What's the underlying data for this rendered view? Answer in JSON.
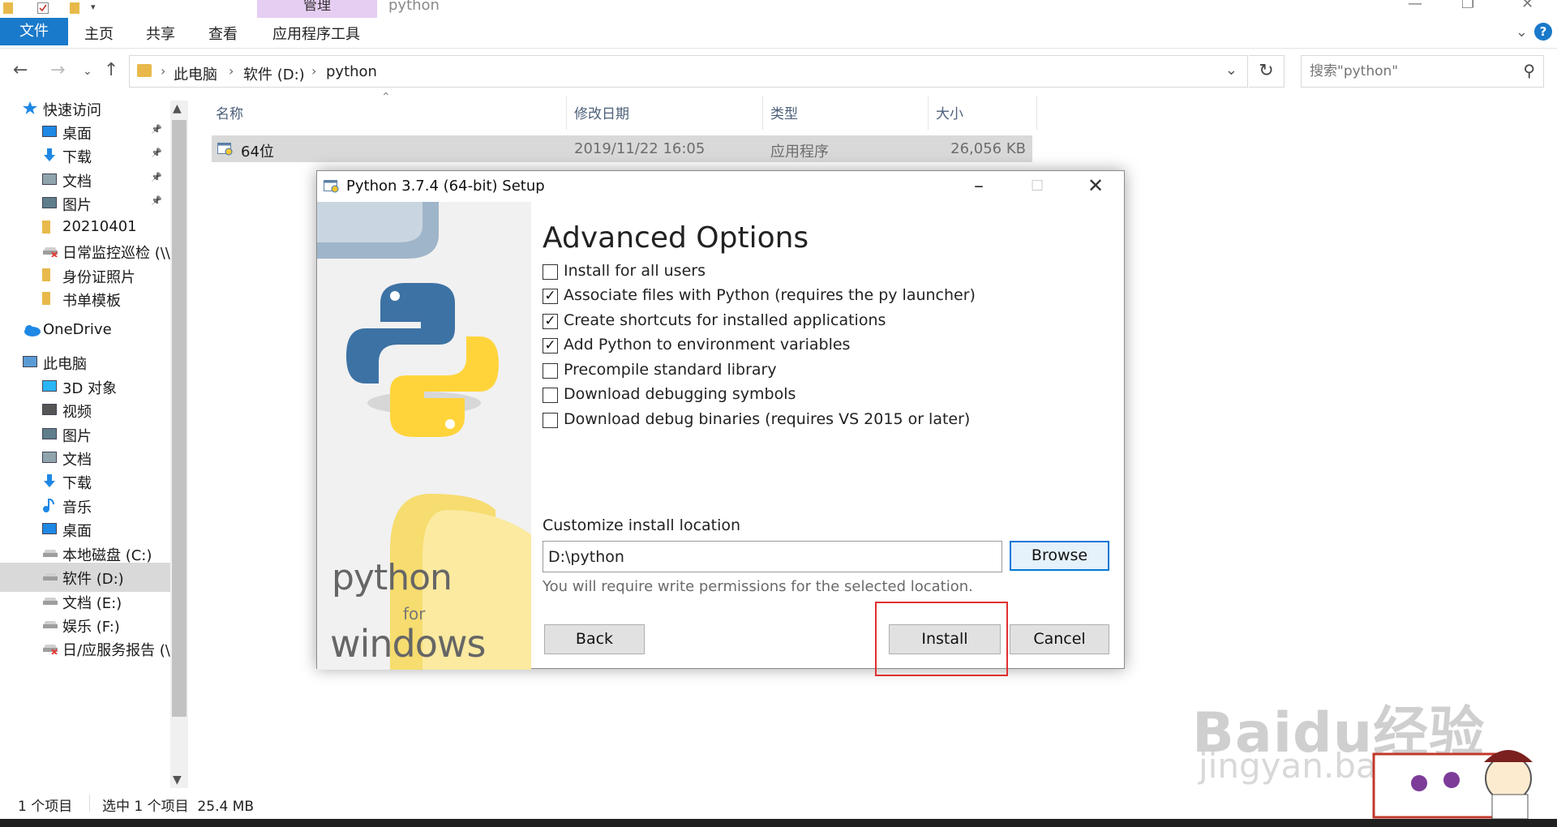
{
  "window": {
    "ribbon_context_tab": "管理",
    "title": "python",
    "file_tab": "文件",
    "tabs": [
      "主页",
      "共享",
      "查看",
      "应用程序工具"
    ],
    "help": "?"
  },
  "address": {
    "crumbs": [
      "此电脑",
      "软件 (D:)",
      "python"
    ],
    "search_placeholder": "搜索\"python\""
  },
  "nav": {
    "items": [
      {
        "label": "快速访问",
        "icon": "star-icon"
      },
      {
        "label": "桌面",
        "icon": "desktop-icon",
        "pinned": true
      },
      {
        "label": "下载",
        "icon": "download-icon",
        "pinned": true
      },
      {
        "label": "文档",
        "icon": "document-icon",
        "pinned": true
      },
      {
        "label": "图片",
        "icon": "picture-icon",
        "pinned": true
      },
      {
        "label": "20210401",
        "icon": "folder-icon"
      },
      {
        "label": "日常监控巡检 (\\\\",
        "icon": "network-drive-icon"
      },
      {
        "label": "身份证照片",
        "icon": "folder-icon"
      },
      {
        "label": "书单模板",
        "icon": "folder-icon"
      },
      {
        "label": "OneDrive",
        "icon": "onedrive-icon"
      },
      {
        "label": "此电脑",
        "icon": "computer-icon"
      },
      {
        "label": "3D 对象",
        "icon": "3d-objects-icon"
      },
      {
        "label": "视频",
        "icon": "video-icon"
      },
      {
        "label": "图片",
        "icon": "picture-icon"
      },
      {
        "label": "文档",
        "icon": "document-icon"
      },
      {
        "label": "下载",
        "icon": "download-icon"
      },
      {
        "label": "音乐",
        "icon": "music-icon"
      },
      {
        "label": "桌面",
        "icon": "desktop-icon"
      },
      {
        "label": "本地磁盘 (C:)",
        "icon": "drive-icon"
      },
      {
        "label": "软件 (D:)",
        "icon": "drive-icon",
        "selected": true
      },
      {
        "label": "文档 (E:)",
        "icon": "drive-icon"
      },
      {
        "label": "娱乐 (F:)",
        "icon": "drive-icon"
      },
      {
        "label": "日/应服务报告 (\\",
        "icon": "network-drive-icon"
      }
    ]
  },
  "files": {
    "columns": [
      "名称",
      "修改日期",
      "类型",
      "大小"
    ],
    "rows": [
      {
        "name": "64位",
        "modified": "2019/11/22 16:05",
        "type": "应用程序",
        "size": "26,056 KB"
      }
    ]
  },
  "status": {
    "count": "1 个项目",
    "selection": "选中 1 个项目  25.4 MB"
  },
  "dialog": {
    "title": "Python 3.7.4 (64-bit) Setup",
    "heading": "Advanced Options",
    "options": [
      {
        "label": "Install for all users",
        "checked": false
      },
      {
        "label": "Associate files with Python (requires the py launcher)",
        "checked": true
      },
      {
        "label": "Create shortcuts for installed applications",
        "checked": true
      },
      {
        "label": "Add Python to environment variables",
        "checked": true
      },
      {
        "label": "Precompile standard library",
        "checked": false
      },
      {
        "label": "Download debugging symbols",
        "checked": false
      },
      {
        "label": "Download debug binaries (requires VS 2015 or later)",
        "checked": false
      }
    ],
    "location_label": "Customize install location",
    "location_value": "D:\\python",
    "browse": "Browse",
    "permission_note": "You will require write permissions for the selected location.",
    "back": "Back",
    "install": "Install",
    "cancel": "Cancel",
    "banner": {
      "line1": "python",
      "line2": "for",
      "line3": "windows"
    }
  },
  "watermark": {
    "logo": "Baidu经验",
    "url": "jingyan.baidu.com"
  },
  "colors": {
    "accent": "#1979ca",
    "highlight": "#e03030",
    "selection": "#d9d9d9"
  }
}
